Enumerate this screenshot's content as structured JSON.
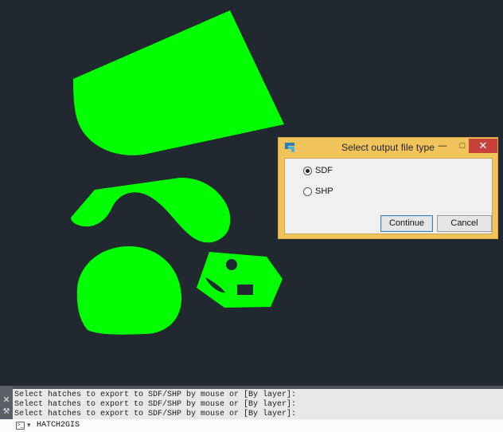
{
  "canvas": {
    "fill_color": "#00ff00",
    "background_color": "#212830"
  },
  "dialog": {
    "title": "Select output file type",
    "icon": "app-logo-icon",
    "minimize_icon": "minimize-icon",
    "maximize_icon": "maximize-icon",
    "close_icon": "close-icon",
    "options": [
      {
        "label": "SDF",
        "selected": true
      },
      {
        "label": "SHP",
        "selected": false
      }
    ],
    "continue_label": "Continue",
    "cancel_label": "Cancel",
    "frame_color": "#f0c45b"
  },
  "command_window": {
    "history": [
      "Select hatches to export to SDF/SHP by mouse or [By layer]:",
      "Select hatches to export to SDF/SHP by mouse or [By layer]:",
      "Select hatches to export to SDF/SHP by mouse or [By layer]:"
    ],
    "input_value": "HATCH2GIS",
    "close_icon": "close-icon",
    "settings_icon": "wrench-icon",
    "prompt_icon": "command-prompt-icon"
  }
}
